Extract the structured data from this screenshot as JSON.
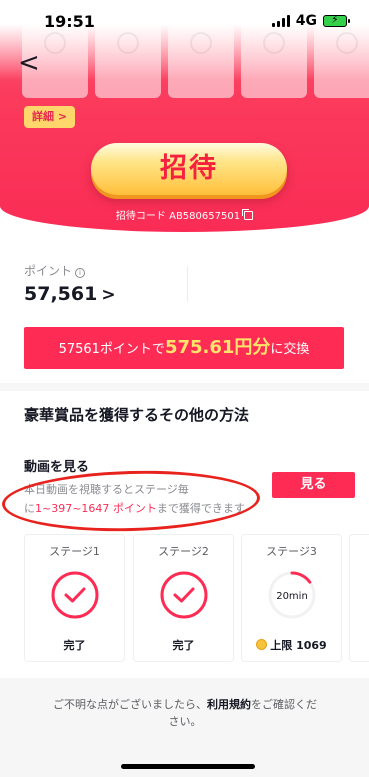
{
  "status_bar": {
    "time": "19:51",
    "network": "4G"
  },
  "header": {
    "back_icon": "chevron-left-icon",
    "back_glyph": "<"
  },
  "hero": {
    "detail_label": "詳細 >",
    "invite_label": "招待",
    "invite_code_text": "招待コード AB580657501",
    "copy_icon": "copy-icon"
  },
  "points": {
    "label": "ポイント",
    "info_icon": "info-icon",
    "value": "57,561",
    "chevron": ">",
    "exchange": {
      "prefix": "57561ポイントで",
      "amount": "575.61円分",
      "suffix": "に交換"
    }
  },
  "other_ways": {
    "title": "豪華賞品を獲得するその他の方法"
  },
  "video_task": {
    "title": "動画を見る",
    "desc_line1": "本日動画を視聴するとステージ毎",
    "desc_prefix": "に",
    "desc_highlight": "1~397~1647 ポイント",
    "desc_suffix": "まで獲得できます",
    "button_label": "見る"
  },
  "stages": [
    {
      "label": "ステージ1",
      "status": "完了",
      "progress": 1.0,
      "done": true
    },
    {
      "label": "ステージ2",
      "status": "完了",
      "progress": 1.0,
      "done": true
    },
    {
      "label": "ステージ3",
      "center_text": "20min",
      "status": "上限 1069",
      "progress": 0.15,
      "done": false
    }
  ],
  "footer": {
    "text_prefix": "ご不明な点がございましたら、",
    "link": "利用規約",
    "text_suffix": "をご確認ください。"
  },
  "colors": {
    "accent": "#fe2c55",
    "gold": "#ffe36b",
    "annotation": "#e8231e"
  }
}
